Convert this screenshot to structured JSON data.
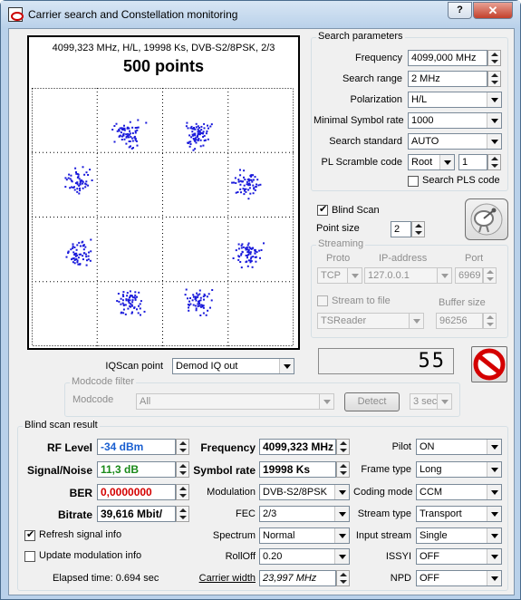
{
  "window": {
    "title": "Carrier search and Constellation monitoring",
    "help_label": "?",
    "close_label": "✕"
  },
  "constellation": {
    "info": "4099,323 MHz, H/L, 19998 Ks, DVB-S2/8PSK, 2/3",
    "points_label": "500 points",
    "point_color": "#1a1adb",
    "iqscan_label": "IQScan point",
    "iqscan_value": "Demod IQ out"
  },
  "search_params": {
    "title": "Search parameters",
    "frequency_label": "Frequency",
    "frequency_value": "4099,000 MHz",
    "range_label": "Search range",
    "range_value": "2 MHz",
    "polarization_label": "Polarization",
    "polarization_value": "H/L",
    "min_sr_label": "Minimal Symbol rate",
    "min_sr_value": "1000",
    "standard_label": "Search standard",
    "standard_value": "AUTO",
    "pl_label": "PL Scramble code",
    "pl_type": "Root",
    "pl_value": "1",
    "pls_label": "Search PLS code"
  },
  "blind": {
    "label": "Blind Scan",
    "point_size_label": "Point size",
    "point_size_value": "2"
  },
  "streaming": {
    "title": "Streaming",
    "proto_label": "Proto",
    "proto_value": "TCP",
    "ip_label": "IP-address",
    "ip_value": "127.0.0.1",
    "port_label": "Port",
    "port_value": "6969",
    "stream_file_label": "Stream to file",
    "buffer_label": "Buffer size",
    "target_value": "TSReader",
    "buffer_value": "96256"
  },
  "counter": {
    "value": "55"
  },
  "modcode_filter": {
    "title": "Modcode filter",
    "modcode_label": "Modcode",
    "modcode_value": "All",
    "detect_label": "Detect",
    "interval_value": "3 sec"
  },
  "result": {
    "title": "Blind scan result",
    "rf_label": "RF Level",
    "rf_value": "-34 dBm",
    "rf_color": "#1a5fd0",
    "snr_label": "Signal/Noise",
    "snr_value": "11,3 dB",
    "snr_color": "#1a8a1a",
    "ber_label": "BER",
    "ber_value": "0,0000000",
    "ber_color": "#d40000",
    "bitrate_label": "Bitrate",
    "bitrate_value": "39,616 Mbit/",
    "freq_label": "Frequency",
    "freq_value": "4099,323 MHz",
    "sr_label": "Symbol rate",
    "sr_value": "19998 Ks",
    "mod_label": "Modulation",
    "mod_value": "DVB-S2/8PSK",
    "fec_label": "FEC",
    "fec_value": "2/3",
    "spectrum_label": "Spectrum",
    "spectrum_value": "Normal",
    "rolloff_label": "RollOff",
    "rolloff_value": "0.20",
    "cw_label": "Carrier width",
    "cw_value": "23,997 MHz",
    "pilot_label": "Pilot",
    "pilot_value": "ON",
    "frame_label": "Frame type",
    "frame_value": "Long",
    "coding_label": "Coding mode",
    "coding_value": "CCM",
    "stype_label": "Stream type",
    "stype_value": "Transport",
    "input_label": "Input stream",
    "input_value": "Single",
    "issyi_label": "ISSYI",
    "issyi_value": "OFF",
    "npd_label": "NPD",
    "npd_value": "OFF",
    "refresh_label": "Refresh signal info",
    "update_label": "Update modulation info",
    "elapsed_label": "Elapsed time: 0.694 sec"
  }
}
